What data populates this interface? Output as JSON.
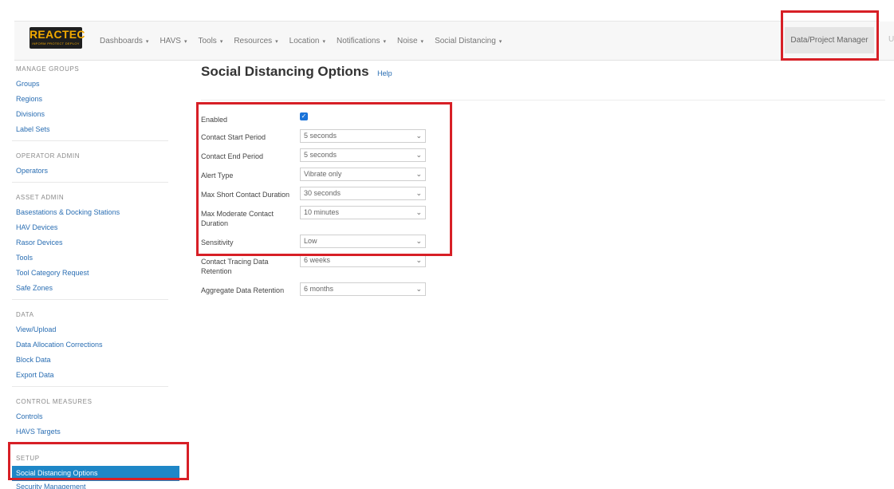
{
  "navbar": {
    "logo": {
      "text": "REACTEC",
      "tagline": "INFORM PROTECT DEPLOY"
    },
    "items": [
      {
        "label": "Dashboards"
      },
      {
        "label": "HAVS"
      },
      {
        "label": "Tools"
      },
      {
        "label": "Resources"
      },
      {
        "label": "Location"
      },
      {
        "label": "Notifications"
      },
      {
        "label": "Noise"
      },
      {
        "label": "Social Distancing"
      }
    ],
    "caret": "▾",
    "right_button": "Data/Project Manager",
    "cut_text": "U"
  },
  "sidebar": {
    "sections": [
      {
        "header": "MANAGE GROUPS",
        "items": [
          "Groups",
          "Regions",
          "Divisions",
          "Label Sets"
        ]
      },
      {
        "header": "OPERATOR ADMIN",
        "items": [
          "Operators"
        ]
      },
      {
        "header": "ASSET ADMIN",
        "items": [
          "Basestations & Docking Stations",
          "HAV Devices",
          "Rasor Devices",
          "Tools",
          "Tool Category Request",
          "Safe Zones"
        ]
      },
      {
        "header": "DATA",
        "items": [
          "View/Upload",
          "Data Allocation Corrections",
          "Block Data",
          "Export Data"
        ]
      },
      {
        "header": "CONTROL MEASURES",
        "items": [
          "Controls",
          "HAVS Targets"
        ]
      },
      {
        "header": "SETUP",
        "items": [
          "Social Distancing Options",
          "Security Management"
        ]
      }
    ],
    "active_item": "Social Distancing Options"
  },
  "main": {
    "title": "Social Distancing Options",
    "help": "Help",
    "form": {
      "enabled_label": "Enabled",
      "enabled_checked": true,
      "fields": [
        {
          "label": "Contact Start Period",
          "value": "5 seconds"
        },
        {
          "label": "Contact End Period",
          "value": "5 seconds"
        },
        {
          "label": "Alert Type",
          "value": "Vibrate only"
        },
        {
          "label": "Max Short Contact Duration",
          "value": "30 seconds"
        },
        {
          "label": "Max Moderate Contact Duration",
          "value": "10 minutes"
        },
        {
          "label": "Sensitivity",
          "value": "Low"
        },
        {
          "label": "Contact Tracing Data Retention",
          "value": "6 weeks"
        },
        {
          "label": "Aggregate Data Retention",
          "value": "6 months"
        }
      ]
    }
  },
  "colors": {
    "highlight": "#d71f26",
    "link": "#2a6eb3",
    "active_bg": "#1e87c7",
    "checkbox": "#1a73d9",
    "brand": "#f2a900"
  },
  "icons": {
    "dropdown": "chevron-down-icon",
    "checkbox": "checkmark-icon"
  }
}
